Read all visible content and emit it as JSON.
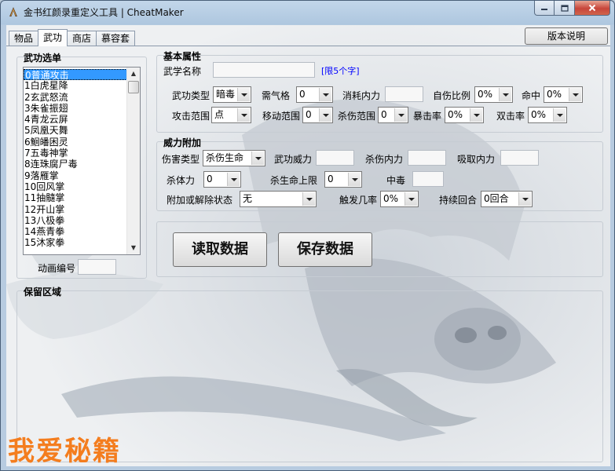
{
  "window": {
    "title": "金书红颜录重定义工具 | CheatMaker"
  },
  "tabs": [
    "物品",
    "武功",
    "商店",
    "慕容套"
  ],
  "version_button": "版本说明",
  "skill_list": {
    "title": "武功选单",
    "items": [
      "0普通攻击",
      "1白虎星降",
      "2玄武怒流",
      "3朱雀振翅",
      "4青龙云屏",
      "5凤凰天舞",
      "6鮰皤困灵",
      "7五毒神掌",
      "8连珠腐尸毒",
      "9落雁掌",
      "10回风掌",
      "11抽髓掌",
      "12开山掌",
      "13八极拳",
      "14燕青拳",
      "15沐家拳"
    ],
    "selected_index": 0,
    "anim_label": "动画编号",
    "anim_value": ""
  },
  "basic": {
    "title": "基本属性",
    "name_label": "武学名称",
    "name_value": "",
    "name_hint": "[限5个字]",
    "type_label": "武功类型",
    "type_value": "暗毒",
    "qi_label": "需气格",
    "qi_value": "0",
    "cost_label": "消耗内力",
    "cost_value": "",
    "selfhurt_label": "自伤比例",
    "selfhurt_value": "0%",
    "hit_label": "命中",
    "hit_value": "0%",
    "range_label": "攻击范围",
    "range_value": "点",
    "move_label": "移动范围",
    "move_value": "0",
    "killrange_label": "杀伤范围",
    "killrange_value": "0",
    "crit_label": "暴击率",
    "crit_value": "0%",
    "double_label": "双击率",
    "double_value": "0%"
  },
  "power": {
    "title": "威力附加",
    "dmgtype_label": "伤害类型",
    "dmgtype_value": "杀伤生命",
    "power_label": "武功威力",
    "power_value": "",
    "killmp_label": "杀伤内力",
    "killmp_value": "",
    "absorb_label": "吸取内力",
    "absorb_value": "",
    "stamina_label": "杀体力",
    "stamina_value": "0",
    "maxhp_label": "杀生命上限",
    "maxhp_value": "0",
    "poison_label": "中毒",
    "poison_value": "",
    "status_label": "附加或解除状态",
    "status_value": "无",
    "trigger_label": "触发几率",
    "trigger_value": "0%",
    "duration_label": "持续回合",
    "duration_value": "0回合"
  },
  "actions": {
    "read": "读取数据",
    "save": "保存数据"
  },
  "reserved": {
    "title": "保留区域"
  },
  "watermark": "我爱秘籍",
  "colors": {
    "selection": "#3399ff",
    "hint": "#0000ff",
    "watermark": "#f47d1e",
    "close": "#c7453a"
  }
}
